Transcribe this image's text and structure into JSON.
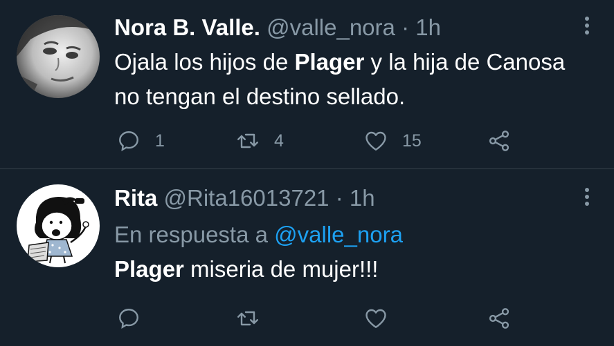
{
  "tweets": [
    {
      "name": "Nora B. Valle.",
      "handle": "@valle_nora",
      "dot": "·",
      "time": "1h",
      "text_parts": [
        "Ojala los hijos de ",
        "Plager",
        " y la hija de Canosa no tengan el destino sellado."
      ],
      "replies": "1",
      "retweets": "4",
      "likes": "15",
      "avatar_icon": "grayscale-face-photo"
    },
    {
      "name": "Rita",
      "handle": "@Rita16013721",
      "dot": "·",
      "time": "1h",
      "reply_prefix": "En respuesta a",
      "reply_mention": "@valle_nora",
      "text_parts": [
        "Plager",
        " miseria de mujer!!!"
      ],
      "avatar_icon": "mafalda-cartoon"
    }
  ],
  "colors": {
    "background": "#15202b",
    "divider": "#38444d",
    "secondary_text": "#8899a6",
    "mention": "#1da1f2"
  }
}
